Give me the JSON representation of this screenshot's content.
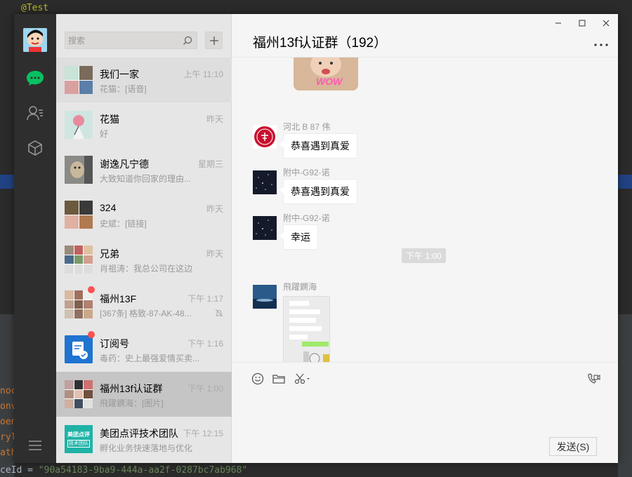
{
  "ide": {
    "annotation": "@Test",
    "bottom_prefix": "ceId = ",
    "bottom_string": "\"90a54183-9ba9-444a-aa2f-0287bc7ab968\"",
    "left_fragments": [
      "noc",
      "onv",
      "oen",
      "ryl",
      "ath"
    ]
  },
  "app": {
    "search": {
      "placeholder": "搜索"
    },
    "add_label": "+",
    "sessions": [
      {
        "name": "我们一家",
        "time": "上午 11:10",
        "preview": "花猫：[语音]"
      },
      {
        "name": "花猫",
        "time": "昨天",
        "preview": "好"
      },
      {
        "name": "谢逸凡宁德",
        "time": "星期三",
        "preview": "大致知道你回家的理由..."
      },
      {
        "name": "324",
        "time": "昨天",
        "preview": "史斌：[链接]"
      },
      {
        "name": "兄弟",
        "time": "昨天",
        "preview": "肖祖涛：我总公司在这边"
      },
      {
        "name": "福州13F",
        "time": "下午 1:17",
        "preview": "[367条] 格致-87-AK-48..."
      },
      {
        "name": "订阅号",
        "time": "下午 1:16",
        "preview": "毒药：史上最强爱情买卖..."
      },
      {
        "name": "福州13f认证群",
        "time": "下午 1:00",
        "preview": "飛躍鐦海：[图片]"
      },
      {
        "name": "美团点评技术团队",
        "time": "下午 12:15",
        "preview": "孵化业务快速落地与优化"
      }
    ],
    "chat": {
      "title": "福州13f认证群（192）",
      "sticker_text": "WOW",
      "messages": [
        {
          "sender": "河北 B 87 伟",
          "text": "恭喜遇到真爱"
        },
        {
          "sender": "附中-G92-诺",
          "text": "恭喜遇到真爱"
        },
        {
          "sender": "附中-G92-诺",
          "text": "幸运"
        }
      ],
      "time_separator": "下午 1:00",
      "image_sender": "飛躍鐦海",
      "send_label": "发送(S)"
    },
    "subscription_logo": "美团点评",
    "subscription_logo2": "技术团队",
    "colors": {
      "unread": "#fa5151",
      "nav_active": "#07c160",
      "sidebar": "#2e2e2e"
    }
  }
}
